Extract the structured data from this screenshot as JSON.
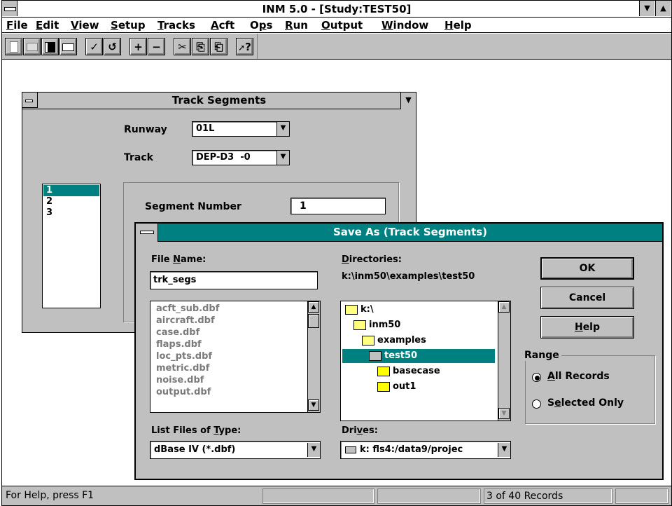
{
  "window": {
    "title": "INM 5.0 - [Study:TEST50]"
  },
  "menu": {
    "file": {
      "pre": "",
      "key": "F",
      "post": "ile"
    },
    "edit": {
      "pre": "",
      "key": "E",
      "post": "dit"
    },
    "view": {
      "pre": "",
      "key": "V",
      "post": "iew"
    },
    "setup": {
      "pre": "",
      "key": "S",
      "post": "etup"
    },
    "tracks": {
      "pre": "",
      "key": "T",
      "post": "racks"
    },
    "acft": {
      "pre": "",
      "key": "A",
      "post": "cft"
    },
    "ops": {
      "pre": "O",
      "key": "p",
      "post": "s"
    },
    "run": {
      "pre": "",
      "key": "R",
      "post": "un"
    },
    "output": {
      "pre": "",
      "key": "O",
      "post": "utput"
    },
    "window": {
      "pre": "",
      "key": "W",
      "post": "indow"
    },
    "help": {
      "pre": "",
      "key": "H",
      "post": "elp"
    }
  },
  "toolbar": {
    "new": "",
    "open": "",
    "save": "",
    "print": "",
    "check": "✓",
    "undo": "↺",
    "add": "+",
    "remove": "−",
    "cut": "✂",
    "copy": "⎘",
    "paste": "⎗",
    "help": "?"
  },
  "track_segments": {
    "title": "Track Segments",
    "runway_label": "Runway",
    "runway_value": "01L",
    "track_label": "Track",
    "track_value": "DEP-D3  -0",
    "segments": [
      "1",
      "2",
      "3"
    ],
    "segment_number_label": "Segment Number",
    "segment_number_value": "1"
  },
  "save_as": {
    "title": "Save As (Track Segments)",
    "file_name_label_pre": "File ",
    "file_name_label_key": "N",
    "file_name_label_post": "ame:",
    "file_name_value": "trk_segs",
    "files": [
      "acft_sub.dbf",
      "aircraft.dbf",
      "case.dbf",
      "flaps.dbf",
      "loc_pts.dbf",
      "metric.dbf",
      "noise.dbf",
      "output.dbf"
    ],
    "directories_label_key": "D",
    "directories_label_post": "irectories:",
    "current_dir": "k:\\inm50\\examples\\test50",
    "dirs": [
      {
        "name": "k:\\",
        "state": "open"
      },
      {
        "name": "inm50",
        "state": "open"
      },
      {
        "name": "examples",
        "state": "open"
      },
      {
        "name": "test50",
        "state": "selected"
      },
      {
        "name": "basecase",
        "state": "closed"
      },
      {
        "name": "out1",
        "state": "closed"
      }
    ],
    "list_type_label_pre": "List Files of ",
    "list_type_label_key": "T",
    "list_type_label_post": "ype:",
    "list_type_value": "dBase IV (*.dbf)",
    "drives_label_pre": "Dri",
    "drives_label_key": "v",
    "drives_label_post": "es:",
    "drive_value": "k: fls4:/data9/projec",
    "ok": "OK",
    "cancel": "Cancel",
    "help_key": "H",
    "help_post": "elp",
    "range_label": "Range",
    "all_records_key": "A",
    "all_records_post": "ll Records",
    "selected_only_pre": "S",
    "selected_only_key": "e",
    "selected_only_post": "lected Only"
  },
  "status": {
    "help_text": "For Help, press F1",
    "records": "3 of 40  Records"
  },
  "colors": {
    "selection": "#008080",
    "face": "#c0c0c0"
  }
}
